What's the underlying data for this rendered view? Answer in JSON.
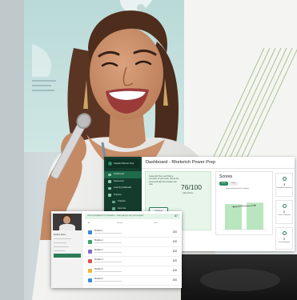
{
  "dashboard": {
    "brand": "Standard Bearer Prep",
    "title": "Dashboard - Rhetorich Power Prep",
    "menu": [
      {
        "label": "Dashboard",
        "active": true,
        "sub": false
      },
      {
        "label": "Resources",
        "active": false,
        "sub": false
      },
      {
        "label": "Learning Materials",
        "active": false,
        "sub": false
      },
      {
        "label": "Practice",
        "active": false,
        "sub": false
      },
      {
        "label": "Practice",
        "active": false,
        "sub": true
      },
      {
        "label": "Exercise",
        "active": false,
        "sub": true
      },
      {
        "label": "Resources",
        "active": false,
        "sub": true
      }
    ],
    "card": {
      "intro": "Great job! Here you'll find a summary of your work. Check the score and take the practice test now.",
      "score": "76/100",
      "score_caption": "Latest Score",
      "button1": "Continue",
      "button2": "Review"
    },
    "scores": {
      "title": "Scores",
      "tabs": [
        "Score",
        "Time"
      ],
      "legend": "Reading   Writing   Math   Composite"
    },
    "stats": [
      {
        "value": "3",
        "label": "Completed Sessions"
      },
      {
        "value": "2",
        "label": "Tests Completed"
      },
      {
        "value": "2",
        "label": "Tests Assigned"
      }
    ],
    "lower_link": "View All Resources"
  },
  "small_panel": {
    "student_name": "Student Name",
    "banner_text": "You've completed 3 of 4 sessions — keep going to see your progress",
    "banner_value": "67",
    "filters": [
      "All",
      "Practice",
      "Tests"
    ],
    "rows": [
      {
        "title": "Practice 1",
        "value": "100",
        "color": "#3a8ad6"
      },
      {
        "title": "Practice 2",
        "value": "100",
        "color": "#3aa06a"
      },
      {
        "title": "Practice 3",
        "value": "100",
        "color": "#8e63c9"
      },
      {
        "title": "Practice 4",
        "value": "100",
        "color": "#e0534f"
      },
      {
        "title": "Practice 5",
        "value": "100",
        "color": "#f0b43a"
      },
      {
        "title": "Practice 6",
        "value": "100",
        "color": "#3a8ad6"
      }
    ]
  },
  "colors": {
    "sidebar": "#143c2c",
    "accent": "#2e7d5a",
    "card_bg": "#e7f5ea",
    "bar": "#b9e6bf"
  },
  "chart_data": {
    "type": "bar",
    "title": "Scores",
    "categories": [
      "Test 1",
      "Test 2"
    ],
    "values": [
      76,
      80
    ],
    "line_values": [
      68,
      72
    ],
    "ylim": [
      0,
      100
    ]
  }
}
